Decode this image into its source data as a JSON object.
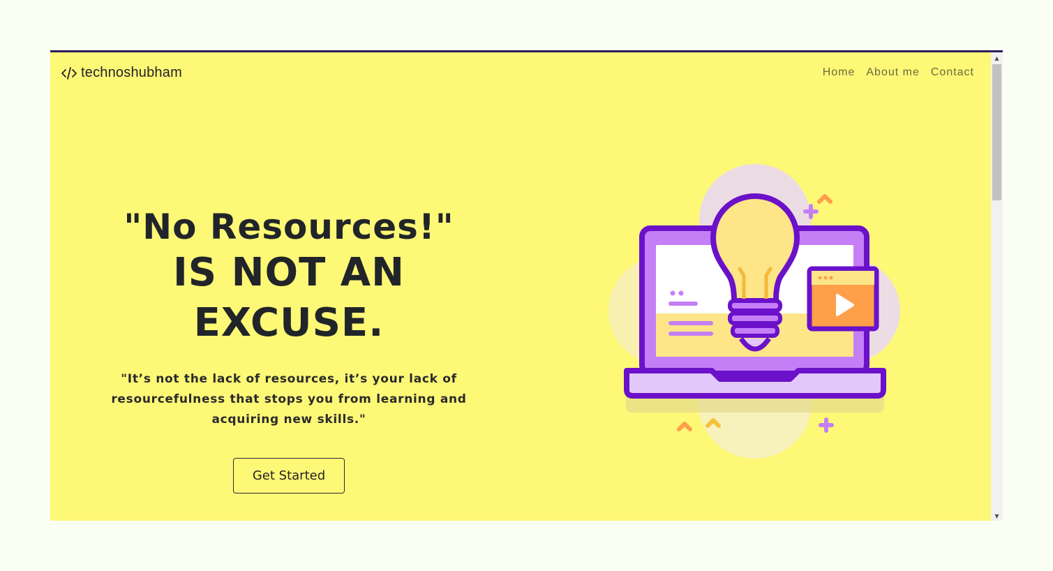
{
  "brand": {
    "name": "technoshubham",
    "icon": "code-icon"
  },
  "nav": {
    "items": [
      {
        "label": "Home"
      },
      {
        "label": "About me"
      },
      {
        "label": "Contact"
      }
    ]
  },
  "hero": {
    "headline_line1": "\"No Resources!\"",
    "headline_line2": "IS NOT AN EXCUSE.",
    "quote": "\"It’s not the lack of resources, it’s your lack of resourcefulness that stops you from learning and acquiring new skills.\"",
    "cta_label": "Get Started",
    "illustration": "laptop-lightbulb-illustration"
  },
  "colors": {
    "page_background": "#fef877",
    "outer_background": "#fbfff3",
    "accent_purple": "#6a11c9",
    "accent_orange": "#ff9f4a"
  }
}
